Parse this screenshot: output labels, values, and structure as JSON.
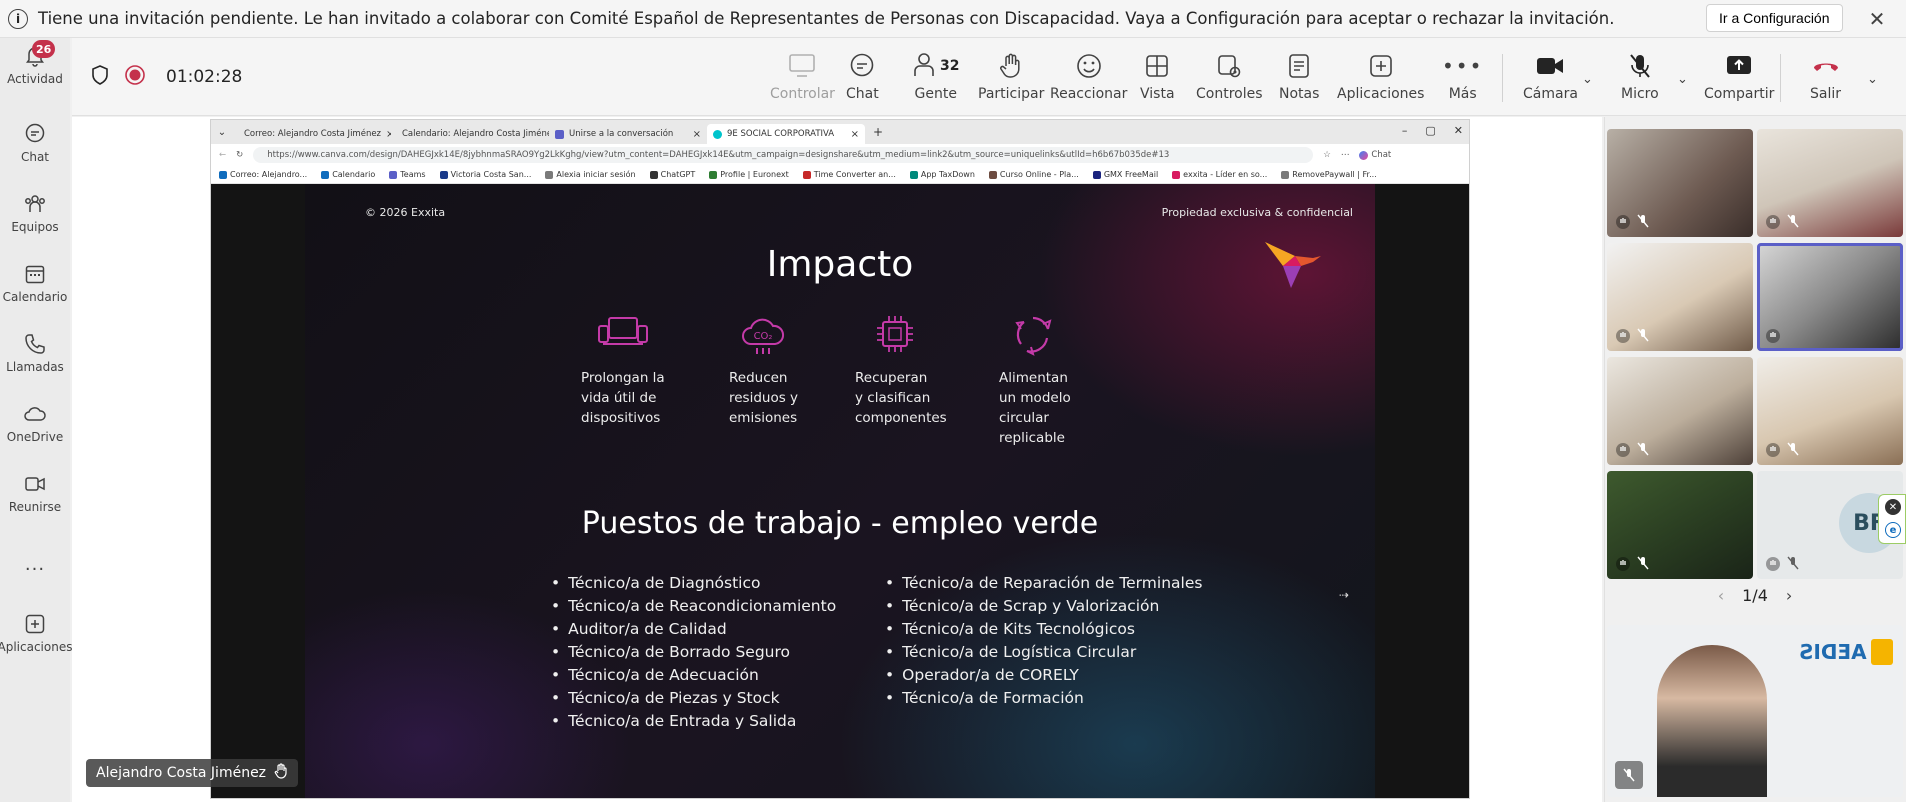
{
  "notification": {
    "message": "Tiene una invitación pendiente. Le han invitado a colaborar con Comité Español de Representantes de Personas con Discapacidad. Vaya a Configuración para aceptar o rechazar la invitación.",
    "action": "Ir a Configuración"
  },
  "rail": {
    "items": [
      {
        "label": "Actividad",
        "icon": "bell-icon",
        "badge": "26"
      },
      {
        "label": "Chat",
        "icon": "chat-icon"
      },
      {
        "label": "Equipos",
        "icon": "teams-icon"
      },
      {
        "label": "Calendario",
        "icon": "calendar-icon"
      },
      {
        "label": "Llamadas",
        "icon": "phone-icon"
      },
      {
        "label": "OneDrive",
        "icon": "cloud-icon"
      },
      {
        "label": "Reunirse",
        "icon": "video-icon"
      },
      {
        "label": "...",
        "icon": "more-icon"
      },
      {
        "label": "Aplicaciones",
        "icon": "add-apps-icon"
      }
    ]
  },
  "toolbar": {
    "timer": "01:02:28",
    "controlar": "Controlar",
    "chat": "Chat",
    "gente": "Gente",
    "gente_count": "32",
    "participar": "Participar",
    "reaccionar": "Reaccionar",
    "vista": "Vista",
    "controles": "Controles",
    "notas": "Notas",
    "aplicaciones": "Aplicaciones",
    "mas": "Más",
    "camara": "Cámara",
    "micro": "Micro",
    "compartir": "Compartir",
    "salir": "Salir"
  },
  "browser": {
    "tabs": [
      "Correo: Alejandro Costa Jiménez",
      "Calendario: Alejandro Costa Jiméne",
      "Unirse a la conversación",
      "9E SOCIAL CORPORATIVA"
    ],
    "url": "https://www.canva.com/design/DAHEGJxk14E/8jybhnmaSRAO9Yg2LkKghg/view?utm_content=DAHEGJxk14E&utm_campaign=designshare&utm_medium=link2&utm_source=uniquelinks&utlId=h6b67b035de#13",
    "chat_btn": "Chat",
    "bookmarks": [
      {
        "label": "Correo: Alejandro...",
        "color": "#0f6cbd"
      },
      {
        "label": "Calendario",
        "color": "#0f6cbd"
      },
      {
        "label": "Teams",
        "color": "#5b5fc7"
      },
      {
        "label": "Victoria Costa San...",
        "color": "#1a3a8a"
      },
      {
        "label": "Alexia iniciar sesión",
        "color": "#7a7a7a"
      },
      {
        "label": "ChatGPT",
        "color": "#333333"
      },
      {
        "label": "Profile | Euronext",
        "color": "#2e7d32"
      },
      {
        "label": "Time Converter an...",
        "color": "#c62828"
      },
      {
        "label": "App TaxDown",
        "color": "#00897b"
      },
      {
        "label": "Curso Online - Pla...",
        "color": "#6d4c41"
      },
      {
        "label": "GMX FreeMail",
        "color": "#1a237e"
      },
      {
        "label": "exxita - Líder en so...",
        "color": "#d81b60"
      },
      {
        "label": "RemovePaywall | Fr...",
        "color": "#7a7a7a"
      }
    ]
  },
  "slide": {
    "copyright": "© 2026 Exxita",
    "confidential": "Propiedad exclusiva & confidencial",
    "title": "Impacto",
    "impacts": [
      {
        "icon": "devices-icon",
        "text": "Prolongan la\nvida útil de\ndispositivos"
      },
      {
        "icon": "co2-cloud-icon",
        "text": "Reducen\nresiduos y\nemisiones"
      },
      {
        "icon": "chip-icon",
        "text": "Recuperan\ny clasifican\ncomponentes"
      },
      {
        "icon": "recycle-icon",
        "text": "Alimentan\nun modelo\ncircular\nreplicable"
      }
    ],
    "subtitle": "Puestos de trabajo - empleo verde",
    "jobs_left": [
      "Técnico/a de Diagnóstico",
      "Técnico/a de Reacondicionamiento",
      "Auditor/a de Calidad",
      "Técnico/a de Borrado Seguro",
      "Técnico/a de Adecuación",
      "Técnico/a de Piezas y Stock",
      "Técnico/a de Entrada y Salida"
    ],
    "jobs_right": [
      "Técnico/a de Reparación de Terminales",
      "Técnico/a de Scrap y Valorización",
      "Técnico/a de Kits Tecnológicos",
      "Técnico/a de Logística Circular",
      "Operador/a de CORELY",
      "Técnico/a de Formación"
    ]
  },
  "presenter": "Alejandro Costa Jiménez",
  "gallery": {
    "initials": "BF",
    "pager": "1/4",
    "logo_text": "AEDIS"
  },
  "colors": {
    "accent": "#5b5fc7",
    "leave": "#c4314b",
    "slide_icon": "#c43aa8"
  }
}
